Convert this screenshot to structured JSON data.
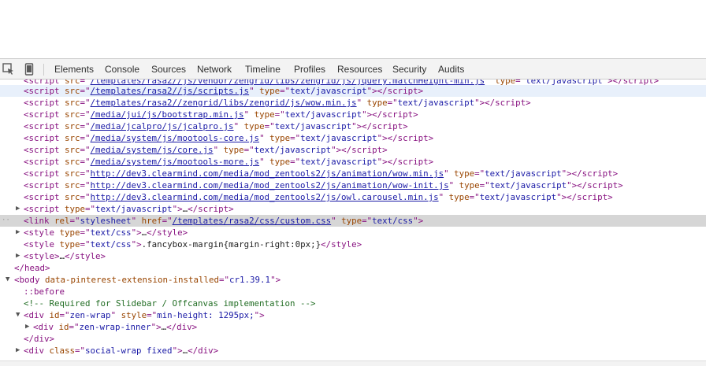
{
  "toolbar": {
    "inspect_icon": "inspect-element-icon",
    "device_icon": "device-mode-icon",
    "tabs": [
      {
        "label": "Elements"
      },
      {
        "label": "Console"
      },
      {
        "label": "Sources"
      },
      {
        "label": "Network"
      },
      {
        "label": "Timeline"
      },
      {
        "label": "Profiles"
      },
      {
        "label": "Resources"
      },
      {
        "label": "Security"
      },
      {
        "label": "Audits"
      }
    ]
  },
  "dom": {
    "line0": {
      "src": "/templates/rasa2//js/vendor/zengrid/libs/zengrid/js/jquery.matchHeight-min.js",
      "type": "text/javascript"
    },
    "line1": {
      "src": "/templates/rasa2//js/scripts.js",
      "type": "text/javascript"
    },
    "line2": {
      "src": "/templates/rasa2//zengrid/libs/zengrid/js/wow.min.js",
      "type": "text/javascript"
    },
    "line3": {
      "src": "/media/jui/js/bootstrap.min.js",
      "type": "text/javascript"
    },
    "line4": {
      "src": "/media/jcalpro/js/jcalpro.js",
      "type": "text/javascript"
    },
    "line5": {
      "src": "/media/system/js/mootools-core.js",
      "type": "text/javascript"
    },
    "line6": {
      "src": "/media/system/js/core.js",
      "type": "text/javascript"
    },
    "line7": {
      "src": "/media/system/js/mootools-more.js",
      "type": "text/javascript"
    },
    "line8": {
      "src": "http://dev3.clearmind.com/media/mod_zentools2/js/animation/wow.min.js",
      "type": "text/javascript"
    },
    "line9": {
      "src": "http://dev3.clearmind.com/media/mod_zentools2/js/animation/wow-init.js",
      "type": "text/javascript"
    },
    "line10": {
      "src": "http://dev3.clearmind.com/media/mod_zentools2/js/owl.carousel.min.js",
      "type": "text/javascript"
    },
    "line11": {
      "type": "text/javascript"
    },
    "line12": {
      "rel": "stylesheet",
      "href": "/templates/rasa2/css/custom.css",
      "type": "text/css"
    },
    "line13": {
      "type": "text/css"
    },
    "line14": {
      "type": "text/css",
      "content": ".fancybox-margin{margin-right:0px;}"
    },
    "line15": {},
    "line16": {},
    "line17": {
      "attr": "data-pinterest-extension-installed",
      "value": "cr1.39.1"
    },
    "line18": {
      "text": "::before"
    },
    "line19": {
      "comment": "<!-- Required for Slidebar / Offcanvas implementation -->"
    },
    "line20": {
      "id": "zen-wrap",
      "style": "min-height: 1295px;"
    },
    "line21": {
      "id": "zen-wrap-inner"
    },
    "line22": {},
    "line23": {
      "class": "social-wrap fixed"
    }
  }
}
